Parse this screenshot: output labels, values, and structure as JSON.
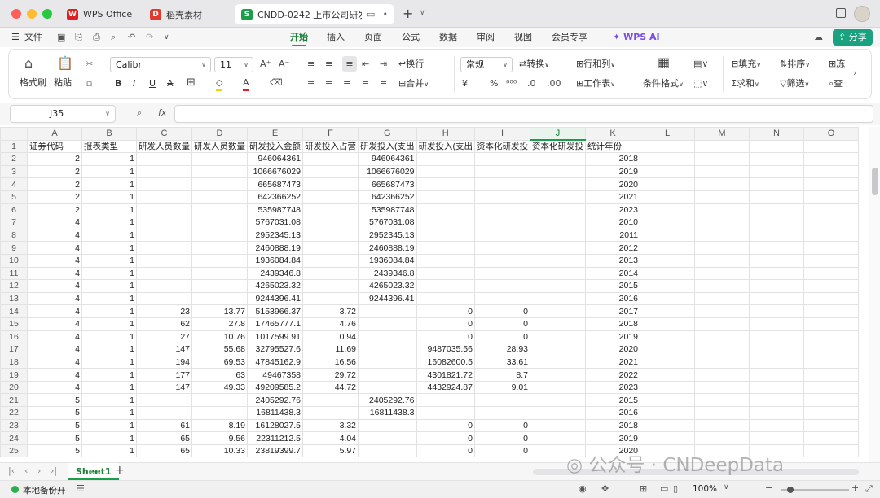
{
  "tabs": [
    {
      "label": "WPS Office",
      "icon": "wps-logo-icon"
    },
    {
      "label": "稻壳素材",
      "icon": "docer-logo-icon"
    },
    {
      "label": "CNDD-0242 上市公司研发",
      "icon": "sheet-file-icon",
      "close": "•"
    }
  ],
  "tab_add": "+",
  "menu": {
    "file": "文件",
    "items": [
      "开始",
      "插入",
      "页面",
      "公式",
      "数据",
      "审阅",
      "视图",
      "会员专享"
    ],
    "active": "开始",
    "ai": "WPS AI",
    "share": "分享"
  },
  "ribbon": {
    "format_painter": "格式刷",
    "paste": "粘贴",
    "font": "Calibri",
    "font_size": "11",
    "wrap": "换行",
    "merge": "合并",
    "number_format": "常规",
    "convert": "转换",
    "rows_cols": "行和列",
    "worksheet": "工作表",
    "cond_format": "条件格式",
    "fill": "填充",
    "sort": "排序",
    "freeze": "冻",
    "sum": "求和",
    "filter": "筛选",
    "find": "查",
    "currency": "¥",
    "percent": "%"
  },
  "namebox": "J35",
  "fx": "fx",
  "columns": [
    "A",
    "B",
    "C",
    "D",
    "E",
    "F",
    "G",
    "H",
    "I",
    "J",
    "K",
    "L",
    "M",
    "N",
    "O"
  ],
  "selected_col": "J",
  "header_row": [
    "证券代码",
    "报表类型",
    "研发人员数量",
    "研发人员数量",
    "研发投入金额",
    "研发投入占营",
    "研发投入(支出",
    "研发投入(支出",
    "资本化研发投",
    "资本化研发投",
    "统计年份",
    "",
    "",
    "",
    ""
  ],
  "rows": [
    [
      "2",
      "1",
      "",
      "",
      "946064361",
      "",
      "946064361",
      "",
      "",
      "",
      "2018"
    ],
    [
      "2",
      "1",
      "",
      "",
      "1066676029",
      "",
      "1066676029",
      "",
      "",
      "",
      "2019"
    ],
    [
      "2",
      "1",
      "",
      "",
      "665687473",
      "",
      "665687473",
      "",
      "",
      "",
      "2020"
    ],
    [
      "2",
      "1",
      "",
      "",
      "642366252",
      "",
      "642366252",
      "",
      "",
      "",
      "2021"
    ],
    [
      "2",
      "1",
      "",
      "",
      "535987748",
      "",
      "535987748",
      "",
      "",
      "",
      "2023"
    ],
    [
      "4",
      "1",
      "",
      "",
      "5767031.08",
      "",
      "5767031.08",
      "",
      "",
      "",
      "2010"
    ],
    [
      "4",
      "1",
      "",
      "",
      "2952345.13",
      "",
      "2952345.13",
      "",
      "",
      "",
      "2011"
    ],
    [
      "4",
      "1",
      "",
      "",
      "2460888.19",
      "",
      "2460888.19",
      "",
      "",
      "",
      "2012"
    ],
    [
      "4",
      "1",
      "",
      "",
      "1936084.84",
      "",
      "1936084.84",
      "",
      "",
      "",
      "2013"
    ],
    [
      "4",
      "1",
      "",
      "",
      "2439346.8",
      "",
      "2439346.8",
      "",
      "",
      "",
      "2014"
    ],
    [
      "4",
      "1",
      "",
      "",
      "4265023.32",
      "",
      "4265023.32",
      "",
      "",
      "",
      "2015"
    ],
    [
      "4",
      "1",
      "",
      "",
      "9244396.41",
      "",
      "9244396.41",
      "",
      "",
      "",
      "2016"
    ],
    [
      "4",
      "1",
      "23",
      "13.77",
      "5153966.37",
      "3.72",
      "",
      "0",
      "0",
      "",
      "2017"
    ],
    [
      "4",
      "1",
      "62",
      "27.8",
      "17465777.1",
      "4.76",
      "",
      "0",
      "0",
      "",
      "2018"
    ],
    [
      "4",
      "1",
      "27",
      "10.76",
      "1017599.91",
      "0.94",
      "",
      "0",
      "0",
      "",
      "2019"
    ],
    [
      "4",
      "1",
      "147",
      "55.68",
      "32795527.6",
      "11.69",
      "",
      "9487035.56",
      "28.93",
      "",
      "2020"
    ],
    [
      "4",
      "1",
      "194",
      "69.53",
      "47845162.9",
      "16.56",
      "",
      "16082600.5",
      "33.61",
      "",
      "2021"
    ],
    [
      "4",
      "1",
      "177",
      "63",
      "49467358",
      "29.72",
      "",
      "4301821.72",
      "8.7",
      "",
      "2022"
    ],
    [
      "4",
      "1",
      "147",
      "49.33",
      "49209585.2",
      "44.72",
      "",
      "4432924.87",
      "9.01",
      "",
      "2023"
    ],
    [
      "5",
      "1",
      "",
      "",
      "2405292.76",
      "",
      "2405292.76",
      "",
      "",
      "",
      "2015"
    ],
    [
      "5",
      "1",
      "",
      "",
      "16811438.3",
      "",
      "16811438.3",
      "",
      "",
      "",
      "2016"
    ],
    [
      "5",
      "1",
      "61",
      "8.19",
      "16128027.5",
      "3.32",
      "",
      "0",
      "0",
      "",
      "2018"
    ],
    [
      "5",
      "1",
      "65",
      "9.56",
      "22311212.5",
      "4.04",
      "",
      "0",
      "0",
      "",
      "2019"
    ],
    [
      "5",
      "1",
      "65",
      "10.33",
      "23819399.7",
      "5.97",
      "",
      "0",
      "0",
      "",
      "2020"
    ]
  ],
  "sheet": {
    "name": "Sheet1",
    "add": "+"
  },
  "status": {
    "backup": "本地备份开",
    "zoom": "100%"
  },
  "watermark": "公众号 · CNDeepData"
}
